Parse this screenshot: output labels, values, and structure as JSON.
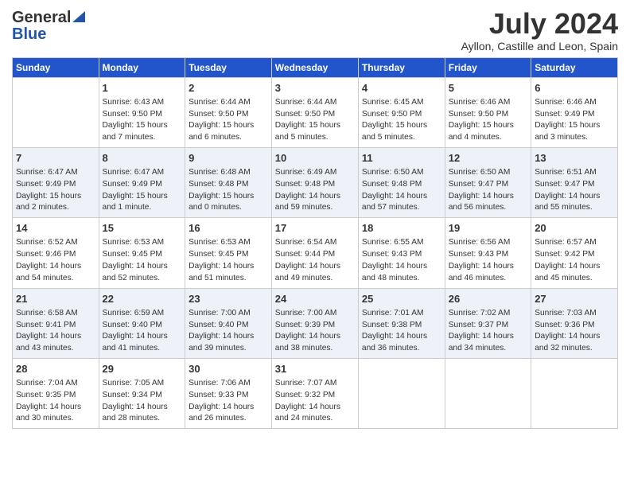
{
  "header": {
    "logo_general": "General",
    "logo_blue": "Blue",
    "month_title": "July 2024",
    "location": "Ayllon, Castille and Leon, Spain"
  },
  "weekdays": [
    "Sunday",
    "Monday",
    "Tuesday",
    "Wednesday",
    "Thursday",
    "Friday",
    "Saturday"
  ],
  "weeks": [
    [
      {
        "day": "",
        "info": ""
      },
      {
        "day": "1",
        "info": "Sunrise: 6:43 AM\nSunset: 9:50 PM\nDaylight: 15 hours\nand 7 minutes."
      },
      {
        "day": "2",
        "info": "Sunrise: 6:44 AM\nSunset: 9:50 PM\nDaylight: 15 hours\nand 6 minutes."
      },
      {
        "day": "3",
        "info": "Sunrise: 6:44 AM\nSunset: 9:50 PM\nDaylight: 15 hours\nand 5 minutes."
      },
      {
        "day": "4",
        "info": "Sunrise: 6:45 AM\nSunset: 9:50 PM\nDaylight: 15 hours\nand 5 minutes."
      },
      {
        "day": "5",
        "info": "Sunrise: 6:46 AM\nSunset: 9:50 PM\nDaylight: 15 hours\nand 4 minutes."
      },
      {
        "day": "6",
        "info": "Sunrise: 6:46 AM\nSunset: 9:49 PM\nDaylight: 15 hours\nand 3 minutes."
      }
    ],
    [
      {
        "day": "7",
        "info": "Sunrise: 6:47 AM\nSunset: 9:49 PM\nDaylight: 15 hours\nand 2 minutes."
      },
      {
        "day": "8",
        "info": "Sunrise: 6:47 AM\nSunset: 9:49 PM\nDaylight: 15 hours\nand 1 minute."
      },
      {
        "day": "9",
        "info": "Sunrise: 6:48 AM\nSunset: 9:48 PM\nDaylight: 15 hours\nand 0 minutes."
      },
      {
        "day": "10",
        "info": "Sunrise: 6:49 AM\nSunset: 9:48 PM\nDaylight: 14 hours\nand 59 minutes."
      },
      {
        "day": "11",
        "info": "Sunrise: 6:50 AM\nSunset: 9:48 PM\nDaylight: 14 hours\nand 57 minutes."
      },
      {
        "day": "12",
        "info": "Sunrise: 6:50 AM\nSunset: 9:47 PM\nDaylight: 14 hours\nand 56 minutes."
      },
      {
        "day": "13",
        "info": "Sunrise: 6:51 AM\nSunset: 9:47 PM\nDaylight: 14 hours\nand 55 minutes."
      }
    ],
    [
      {
        "day": "14",
        "info": "Sunrise: 6:52 AM\nSunset: 9:46 PM\nDaylight: 14 hours\nand 54 minutes."
      },
      {
        "day": "15",
        "info": "Sunrise: 6:53 AM\nSunset: 9:45 PM\nDaylight: 14 hours\nand 52 minutes."
      },
      {
        "day": "16",
        "info": "Sunrise: 6:53 AM\nSunset: 9:45 PM\nDaylight: 14 hours\nand 51 minutes."
      },
      {
        "day": "17",
        "info": "Sunrise: 6:54 AM\nSunset: 9:44 PM\nDaylight: 14 hours\nand 49 minutes."
      },
      {
        "day": "18",
        "info": "Sunrise: 6:55 AM\nSunset: 9:43 PM\nDaylight: 14 hours\nand 48 minutes."
      },
      {
        "day": "19",
        "info": "Sunrise: 6:56 AM\nSunset: 9:43 PM\nDaylight: 14 hours\nand 46 minutes."
      },
      {
        "day": "20",
        "info": "Sunrise: 6:57 AM\nSunset: 9:42 PM\nDaylight: 14 hours\nand 45 minutes."
      }
    ],
    [
      {
        "day": "21",
        "info": "Sunrise: 6:58 AM\nSunset: 9:41 PM\nDaylight: 14 hours\nand 43 minutes."
      },
      {
        "day": "22",
        "info": "Sunrise: 6:59 AM\nSunset: 9:40 PM\nDaylight: 14 hours\nand 41 minutes."
      },
      {
        "day": "23",
        "info": "Sunrise: 7:00 AM\nSunset: 9:40 PM\nDaylight: 14 hours\nand 39 minutes."
      },
      {
        "day": "24",
        "info": "Sunrise: 7:00 AM\nSunset: 9:39 PM\nDaylight: 14 hours\nand 38 minutes."
      },
      {
        "day": "25",
        "info": "Sunrise: 7:01 AM\nSunset: 9:38 PM\nDaylight: 14 hours\nand 36 minutes."
      },
      {
        "day": "26",
        "info": "Sunrise: 7:02 AM\nSunset: 9:37 PM\nDaylight: 14 hours\nand 34 minutes."
      },
      {
        "day": "27",
        "info": "Sunrise: 7:03 AM\nSunset: 9:36 PM\nDaylight: 14 hours\nand 32 minutes."
      }
    ],
    [
      {
        "day": "28",
        "info": "Sunrise: 7:04 AM\nSunset: 9:35 PM\nDaylight: 14 hours\nand 30 minutes."
      },
      {
        "day": "29",
        "info": "Sunrise: 7:05 AM\nSunset: 9:34 PM\nDaylight: 14 hours\nand 28 minutes."
      },
      {
        "day": "30",
        "info": "Sunrise: 7:06 AM\nSunset: 9:33 PM\nDaylight: 14 hours\nand 26 minutes."
      },
      {
        "day": "31",
        "info": "Sunrise: 7:07 AM\nSunset: 9:32 PM\nDaylight: 14 hours\nand 24 minutes."
      },
      {
        "day": "",
        "info": ""
      },
      {
        "day": "",
        "info": ""
      },
      {
        "day": "",
        "info": ""
      }
    ]
  ]
}
